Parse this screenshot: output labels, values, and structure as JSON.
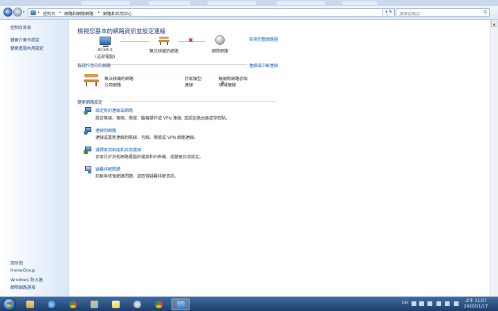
{
  "breadcrumb": {
    "items": [
      "控制台",
      "網路和網際網路",
      "網路和共用中心"
    ]
  },
  "search": {
    "placeholder": "搜尋控制台"
  },
  "sidebar": {
    "home": "控制台首頁",
    "links": [
      "變更介面卡設定",
      "變更進階共用設定"
    ],
    "see_also_title": "請參閱",
    "see_also": [
      "HomeGroup",
      "Windows 防火牆",
      "網際網路選項"
    ]
  },
  "main": {
    "heading": "檢視您基本的網路資訊並設定連線",
    "full_map_link": "檢視完整網路圖",
    "network_map": {
      "computer_name": "ACER-X",
      "computer_sub": "(這部電腦)",
      "network": "無法辨識的網路",
      "internet": "網際網路"
    },
    "active_section": {
      "title": "檢視作用中的網路",
      "connect_link": "連線或中斷連線",
      "network_name": "無法辨識的網路",
      "network_type": "公用網路",
      "access_type_label": "存取類型:",
      "access_type_value": "無網際網路存取",
      "connections_label": "連線:",
      "connection_value": "區域連線"
    },
    "change_section": {
      "title": "變更網路設定",
      "tasks": [
        {
          "title": "設定新的連線或網路",
          "desc": "設定無線、寬頻、撥號、臨機操作或 VPN 連線; 或設定路由器或存取點。"
        },
        {
          "title": "連線到網路",
          "desc": "連線或重新連線到無線、有線、撥號或 VPN 網路連線。"
        },
        {
          "title": "選擇家用群組和共用選項",
          "desc": "存取位於其他網路電腦的檔案和印表機，或變更共用設定。"
        },
        {
          "title": "疑難排解問題",
          "desc": "診斷與修復網路問題，或取得疑難排解資訊。"
        }
      ]
    }
  },
  "taskbar": {
    "lang": "CH",
    "time": "上午 11:07",
    "date": "2020/11/17"
  }
}
